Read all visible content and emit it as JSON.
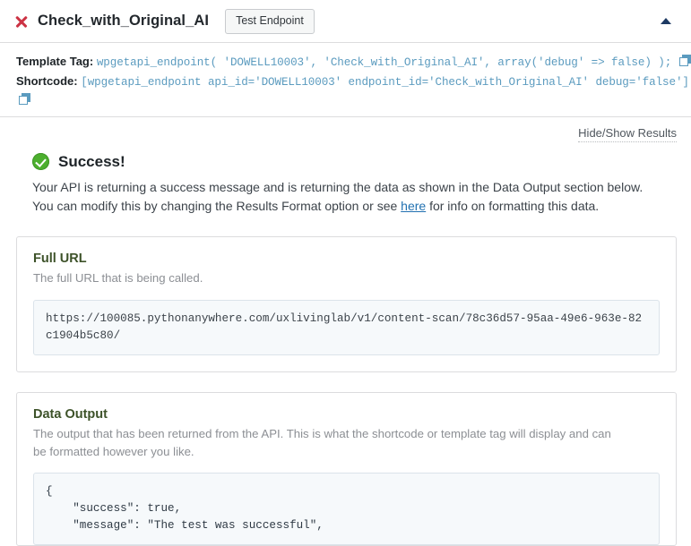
{
  "header": {
    "close_icon": "close-x-icon",
    "title": "Check_with_Original_AI",
    "test_button_label": "Test Endpoint",
    "collapse_icon": "caret-up-icon"
  },
  "code_meta": {
    "template_tag_label": "Template Tag:",
    "template_tag_code": "wpgetapi_endpoint( 'DOWELL10003', 'Check_with_Original_AI', array('debug' => false) );",
    "template_tag_copy_icon": "copy-icon",
    "shortcode_label": "Shortcode:",
    "shortcode_code": "[wpgetapi_endpoint api_id='DOWELL10003' endpoint_id='Check_with_Original_AI' debug='false']",
    "shortcode_copy_icon": "copy-icon"
  },
  "results": {
    "hide_show_label": "Hide/Show Results",
    "status_icon": "success-check-icon",
    "status_title": "Success!",
    "description_line_1": "Your API is returning a success message and is returning the data as shown in the Data Output section below.",
    "description_line_2_before": "You can modify this by changing the Results Format option or see ",
    "description_link": "here",
    "description_line_2_after": " for info on formatting this data."
  },
  "full_url_panel": {
    "title": "Full URL",
    "subtitle": "The full URL that is being called.",
    "url": "https://100085.pythonanywhere.com/uxlivinglab/v1/content-scan/78c36d57-95aa-49e6-963e-82c1904b5c80/"
  },
  "data_output_panel": {
    "title": "Data Output",
    "subtitle": "The output that has been returned from the API. This is what the shortcode or template tag will display and can be formatted however you like.",
    "json": "{\n    \"success\": true,\n    \"message\": \"The test was successful\","
  },
  "colors": {
    "accent_blue": "#5b9bbf",
    "success_green": "#4CAF2E",
    "close_red": "#cc3344",
    "link_blue": "#2271b1",
    "panel_title_olive": "#3d5229",
    "caret_navy": "#1d3a63"
  }
}
